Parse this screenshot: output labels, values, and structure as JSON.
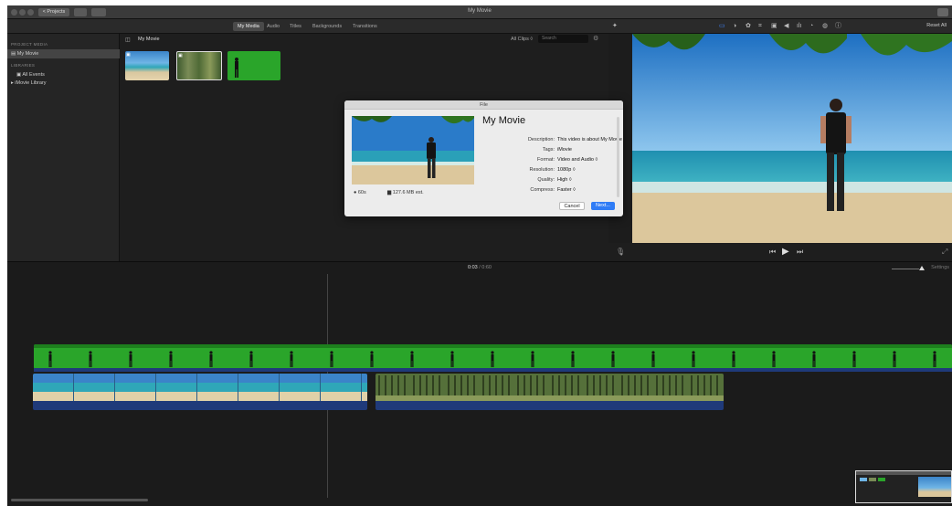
{
  "window": {
    "title": "My Movie",
    "back_label": "< Projects"
  },
  "toolbar": {
    "tabs": [
      {
        "label": "My Media",
        "active": true
      },
      {
        "label": "Audio",
        "active": false
      },
      {
        "label": "Titles",
        "active": false
      },
      {
        "label": "Backgrounds",
        "active": false
      },
      {
        "label": "Transitions",
        "active": false
      }
    ],
    "reset_all": "Reset All"
  },
  "sidebar": {
    "project_media_heading": "PROJECT MEDIA",
    "project_item": "My Movie",
    "libraries_heading": "LIBRARIES",
    "all_events": "All Events",
    "library": "iMovie Library"
  },
  "browser": {
    "title": "My Movie",
    "all_clips": "All Clips ◊",
    "search_placeholder": "Search"
  },
  "timeline": {
    "current_time": "0:03",
    "duration": "/ 0:60",
    "settings": "Settings"
  },
  "dialog": {
    "window_title": "File",
    "heading": "My Movie",
    "duration": "60s",
    "size_estimate": "127.6 MB est.",
    "fields": [
      {
        "label": "Description:",
        "value": "This video is about My Movie"
      },
      {
        "label": "Tags:",
        "value": "iMovie"
      },
      {
        "label": "Format:",
        "value": "Video and Audio ◊"
      },
      {
        "label": "Resolution:",
        "value": "1080p ◊"
      },
      {
        "label": "Quality:",
        "value": "High ◊"
      },
      {
        "label": "Compress:",
        "value": "Faster ◊"
      }
    ],
    "cancel_label": "Cancel",
    "next_label": "Next..."
  },
  "colors": {
    "accent": "#2f7cf6",
    "green_screen": "#2aa52a",
    "timeline_audio": "#1f3a7a"
  }
}
